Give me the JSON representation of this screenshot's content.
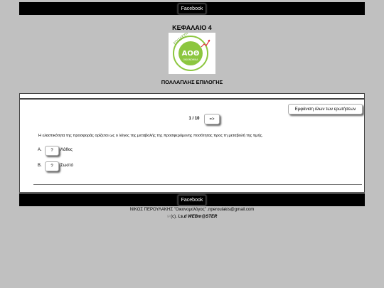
{
  "header": {
    "facebook_label": "Facebook"
  },
  "chapter_title": "ΚΕΦΑΛΑΙΟ 4",
  "logo": {
    "ring_text": "ΕΠΙΣΚΕΥΗ",
    "main_text": "ΑΟΘ",
    "sub_text": "ΟΙΚΟΝΟΜΙΚΑ"
  },
  "subtitle": "ΠΟΛΛΑΠΛΗΣ ΕΠΙΛΟΓΗΣ",
  "quiz": {
    "show_all_label": "Εμφάνιση όλων των ερωτήσεων",
    "counter": "1 / 10",
    "next_label": "=>",
    "question": "Η ελαστικότητα της προσφοράς ορίζεται ως ο λόγος της μεταβολής της προσφερόμενης ποσότητας προς τη μεταβολή της τιμής.",
    "options": [
      {
        "letter": "A.",
        "button": "?",
        "text": "Λάθος"
      },
      {
        "letter": "B.",
        "button": "?",
        "text": "Σωστό"
      }
    ]
  },
  "footer": {
    "facebook_label": "Facebook",
    "author_line": "ΝΙΚΟΣ ΠΕΡΟΥΛΑΚΗΣ \"Οικονομολόγος\" ,nperoulakis@gmail.com",
    "copyright_prefix": "(c).",
    "copyright_brand": "i.s.d WEBm@STER"
  }
}
